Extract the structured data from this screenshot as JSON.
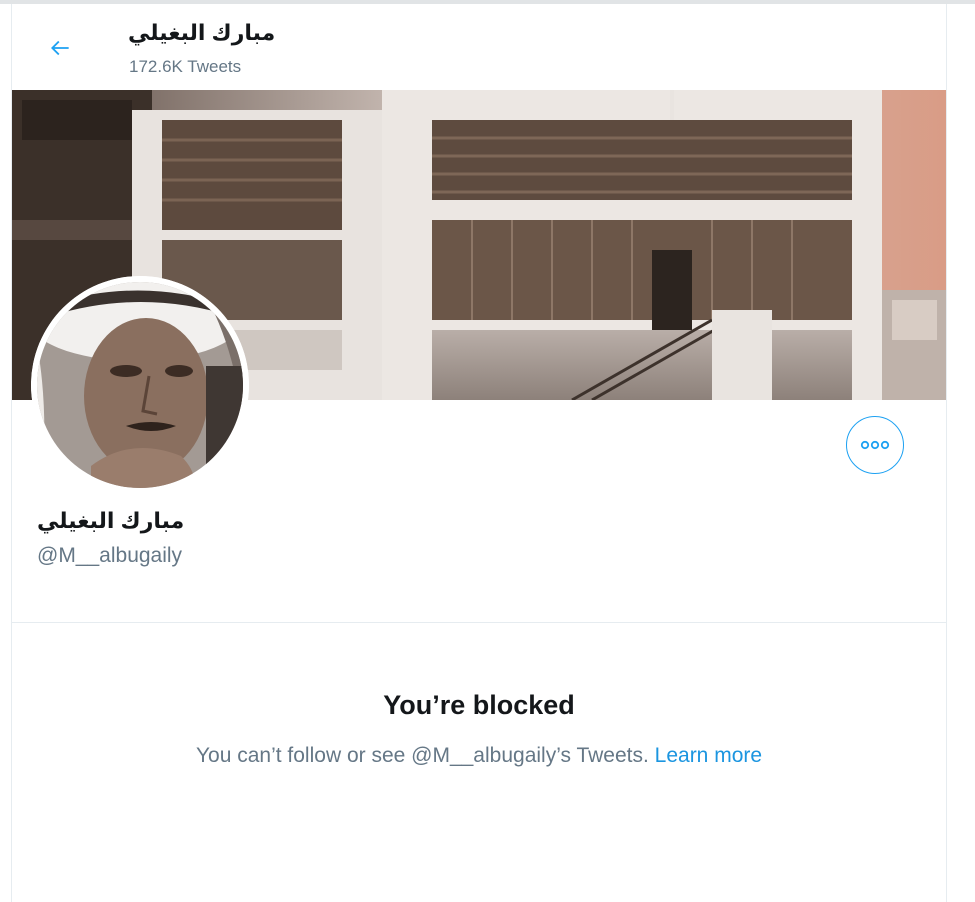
{
  "header": {
    "title": "مبارك البغيلي",
    "tweet_count": "172.6K Tweets",
    "back_icon": "arrow-left-icon"
  },
  "banner": {
    "description_icon": "cover-photo"
  },
  "profile": {
    "name": "مبارك البغيلي",
    "handle": "@M__albugaily",
    "more_icon": "more-icon"
  },
  "blocked": {
    "title": "You’re blocked",
    "message": "You can’t follow or see @M__albugaily’s Tweets.",
    "link_label": "Learn more"
  },
  "colors": {
    "accent": "#1da1f2",
    "link": "#1b95e0",
    "text": "#14171a",
    "secondary_text": "#657786",
    "border": "#e6ecf0"
  }
}
